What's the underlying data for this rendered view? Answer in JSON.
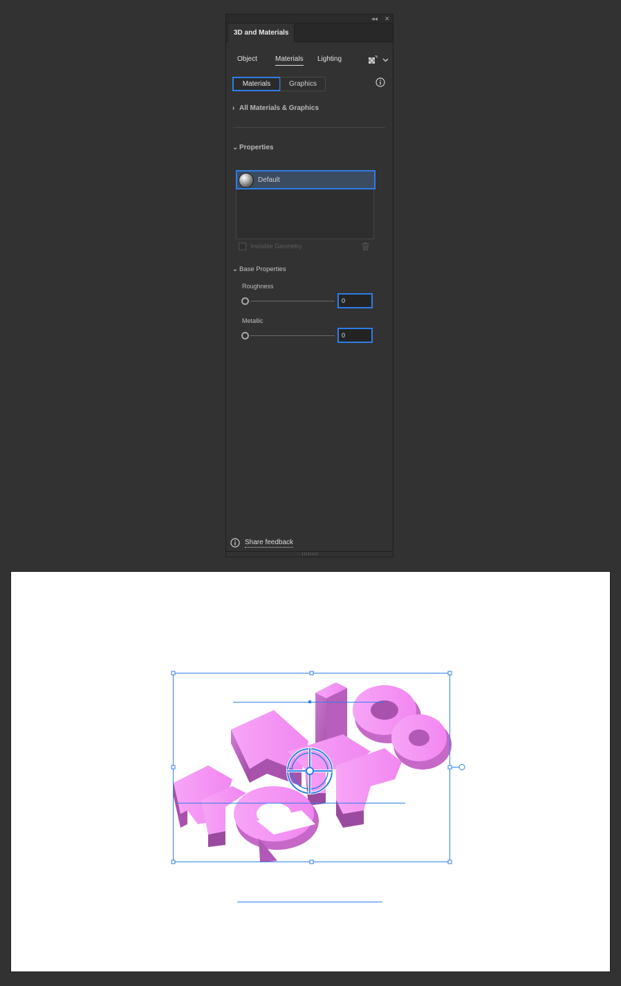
{
  "panel": {
    "title": "3D and Materials",
    "collapse_icon": "double-chevron-left-icon",
    "close_icon": "close-icon",
    "collapse_glyph": "◂◂",
    "close_glyph": "✕",
    "mode_tabs": [
      {
        "label": "Object",
        "active": false
      },
      {
        "label": "Materials",
        "active": true
      },
      {
        "label": "Lighting",
        "active": false
      }
    ],
    "render_icon": "render-settings-icon",
    "segments": [
      {
        "label": "Materials",
        "active": true
      },
      {
        "label": "Graphics",
        "active": false
      }
    ],
    "all_materials_label": "All Materials & Graphics",
    "properties_label": "Properties",
    "materials": [
      {
        "label": "Default",
        "selected": true,
        "thumb": "sphere-material-thumbnail"
      }
    ],
    "invisible_geometry_label": "Invisible Geometry",
    "invisible_geometry_checked": false,
    "base_properties_label": "Base Properties",
    "roughness": {
      "label": "Roughness",
      "value": "0",
      "level": 0
    },
    "metallic": {
      "label": "Metallic",
      "value": "0",
      "level": 0
    },
    "share_feedback_label": "Share feedback"
  },
  "canvas": {
    "background": "#ffffff",
    "selection_color": "#2e7ee8",
    "artwork": "isometric-3d-text",
    "text_fill": "#f58ef5",
    "text_side": "#c568c8",
    "text_dark": "#9a4ba0"
  },
  "colors": {
    "app_bg": "#323232",
    "accent": "#2e7ee8",
    "selected_row": "#3b4c61"
  }
}
